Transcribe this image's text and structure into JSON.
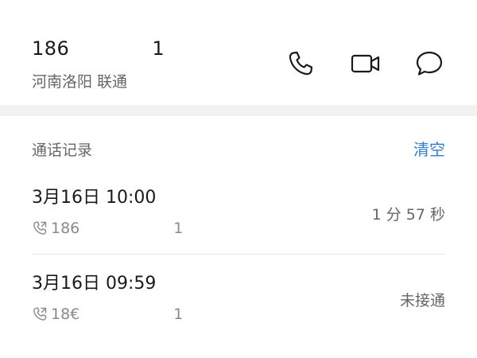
{
  "contact": {
    "number_start": "186",
    "number_end": "1",
    "location": "河南洛阳 联通"
  },
  "actions": {
    "call_icon": "phone-icon",
    "video_icon": "video-camera-icon",
    "message_icon": "message-bubble-icon"
  },
  "history": {
    "title": "通话记录",
    "clear_label": "清空",
    "records": [
      {
        "time": "3月16日 10:00",
        "number_start": "186",
        "number_end": "1",
        "status": "1 分 57 秒"
      },
      {
        "time": "3月16日 09:59",
        "number_start": "18€",
        "number_end": "1",
        "status": "未接通"
      }
    ]
  },
  "colors": {
    "accent": "#2f7fd1",
    "primary_text": "#1a1a1a",
    "secondary_text": "#666666",
    "background": "#f2f2f2"
  }
}
